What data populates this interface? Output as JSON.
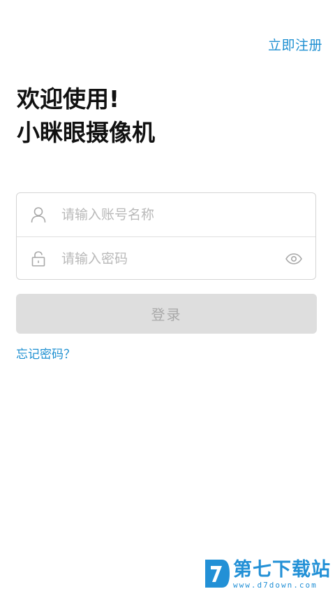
{
  "header": {
    "register_label": "立即注册"
  },
  "welcome": {
    "line1": "欢迎使用!",
    "line2": "小眯眼摄像机"
  },
  "form": {
    "account": {
      "placeholder": "请输入账号名称",
      "value": "",
      "icon": "user-icon"
    },
    "password": {
      "placeholder": "请输入密码",
      "value": "",
      "icon": "lock-icon",
      "toggle_icon": "eye-icon"
    }
  },
  "login_button": {
    "label": "登录",
    "state": "disabled"
  },
  "forgot_password": {
    "label": "忘记密码？"
  },
  "watermark": {
    "title": "第七下载站",
    "url": "www.d7down.com"
  },
  "colors": {
    "accent": "#1d8fd1",
    "button_disabled_bg": "#dedede",
    "button_disabled_text": "#a9a9a9",
    "placeholder": "#b9b9b9"
  }
}
